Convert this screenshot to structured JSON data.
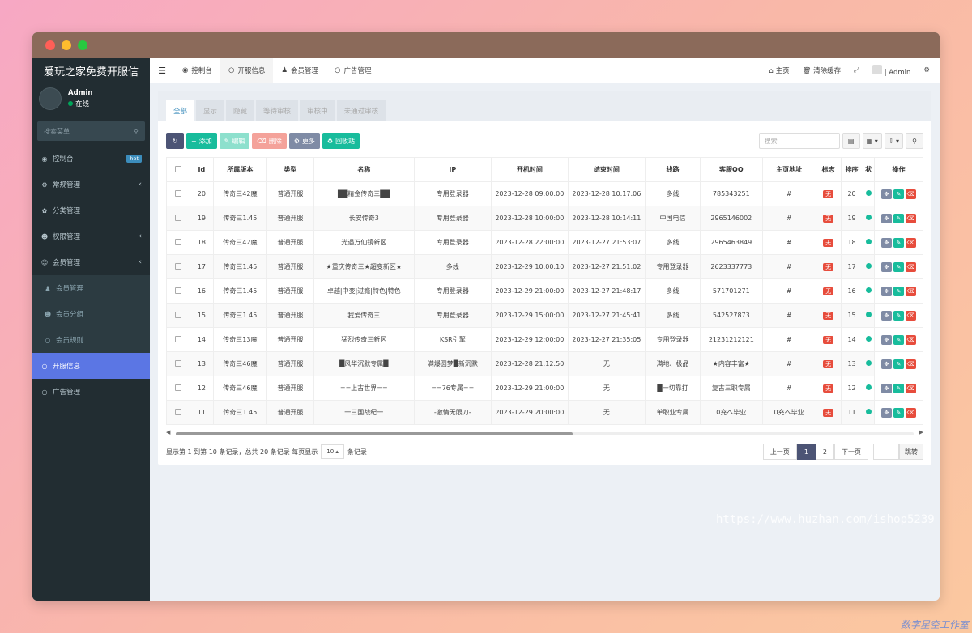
{
  "app": {
    "title": "爱玩之家免费开服信"
  },
  "user": {
    "name": "Admin",
    "status": "在线"
  },
  "sidebar": {
    "search_placeholder": "搜索菜单",
    "items": [
      {
        "label": "控制台",
        "badge": "hot"
      },
      {
        "label": "常规管理"
      },
      {
        "label": "分类管理"
      },
      {
        "label": "权限管理"
      },
      {
        "label": "会员管理"
      }
    ],
    "submenu": [
      {
        "label": "会员管理"
      },
      {
        "label": "会员分组"
      },
      {
        "label": "会员规则"
      }
    ],
    "after": [
      {
        "label": "开服信息"
      },
      {
        "label": "广告管理"
      }
    ]
  },
  "topnav": {
    "tabs": [
      "控制台",
      "开服信息",
      "会员管理",
      "广告管理"
    ],
    "right": {
      "home": "主页",
      "clear_cache": "清除缓存",
      "admin": "Admin"
    }
  },
  "subtabs": [
    "全部",
    "显示",
    "隐藏",
    "等待审核",
    "审核中",
    "未通过审核"
  ],
  "toolbar": {
    "add": "添加",
    "edit": "编辑",
    "delete": "删除",
    "more": "更多",
    "recycle": "回收站",
    "search_placeholder": "搜索"
  },
  "table": {
    "headers": [
      "Id",
      "所属版本",
      "类型",
      "名称",
      "IP",
      "开机时间",
      "结束时间",
      "线路",
      "客服QQ",
      "主页地址",
      "标志",
      "排序",
      "状",
      "操作"
    ],
    "rows": [
      [
        "20",
        "传奇三42魔",
        "普通开服",
        "██精金传奇三██",
        "专用登录器",
        "2023-12-28 09:00:00",
        "2023-12-28 10:17:06",
        "多线",
        "785343251",
        "#",
        "无",
        "20"
      ],
      [
        "19",
        "传奇三1.45",
        "普通开服",
        "长安传奇3",
        "专用登录器",
        "2023-12-28 10:00:00",
        "2023-12-28 10:14:11",
        "中国电信",
        "2965146002",
        "#",
        "无",
        "19"
      ],
      [
        "18",
        "传奇三42魔",
        "普通开服",
        "光遇万仙镜新区",
        "专用登录器",
        "2023-12-28 22:00:00",
        "2023-12-27 21:53:07",
        "多线",
        "2965463849",
        "#",
        "无",
        "18"
      ],
      [
        "17",
        "传奇三1.45",
        "普通开服",
        "★重庆传奇三★超变新区★",
        "多线",
        "2023-12-29 10:00:10",
        "2023-12-27 21:51:02",
        "专用登录器",
        "2623337773",
        "#",
        "无",
        "17"
      ],
      [
        "16",
        "传奇三1.45",
        "普通开服",
        "卓越|中变|过瘾|特色|特色",
        "专用登录器",
        "2023-12-29 21:00:00",
        "2023-12-27 21:48:17",
        "多线",
        "571701271",
        "#",
        "无",
        "16"
      ],
      [
        "15",
        "传奇三1.45",
        "普通开服",
        "我爱传奇三",
        "专用登录器",
        "2023-12-29 15:00:00",
        "2023-12-27 21:45:41",
        "多线",
        "542527873",
        "#",
        "无",
        "15"
      ],
      [
        "14",
        "传奇三13魔",
        "普通开服",
        "猛烈传奇三新区",
        "KSR引擎",
        "2023-12-29 12:00:00",
        "2023-12-27 21:35:05",
        "专用登录器",
        "21231212121",
        "#",
        "无",
        "14"
      ],
      [
        "13",
        "传奇三46魔",
        "普通开服",
        "█风华沉默专属█",
        "满爆圆梦█新沉默",
        "2023-12-28 21:12:50",
        "无",
        "满地、极品",
        "★内容丰富★",
        "#",
        "无",
        "13"
      ],
      [
        "12",
        "传奇三46魔",
        "普通开服",
        "==上古世界==",
        "==76专属==",
        "2023-12-29 21:00:00",
        "无",
        "█一切靠打",
        "复古三职专属",
        "#",
        "无",
        "12"
      ],
      [
        "11",
        "传奇三1.45",
        "普通开服",
        "一三国战纪一",
        "-激情无限刀-",
        "2023-12-29 20:00:00",
        "无",
        "单职业专属",
        "0充へ毕业",
        "0充へ毕业",
        "无",
        "11"
      ]
    ]
  },
  "footer": {
    "summary_prefix": "显示第 1 到第 10 条记录，总共 20 条记录 每页显示",
    "page_size": "10",
    "summary_suffix": "条记录",
    "prev": "上一页",
    "next": "下一页",
    "pages": [
      "1",
      "2"
    ],
    "jump": "跳转"
  },
  "watermark": "https://www.huzhan.com/ishop5239",
  "corner_mark": "数字星空工作室",
  "colors": {
    "sidebar": "#222d32",
    "active": "#5b76e4",
    "success": "#18bc9c",
    "danger": "#e74c3c"
  }
}
